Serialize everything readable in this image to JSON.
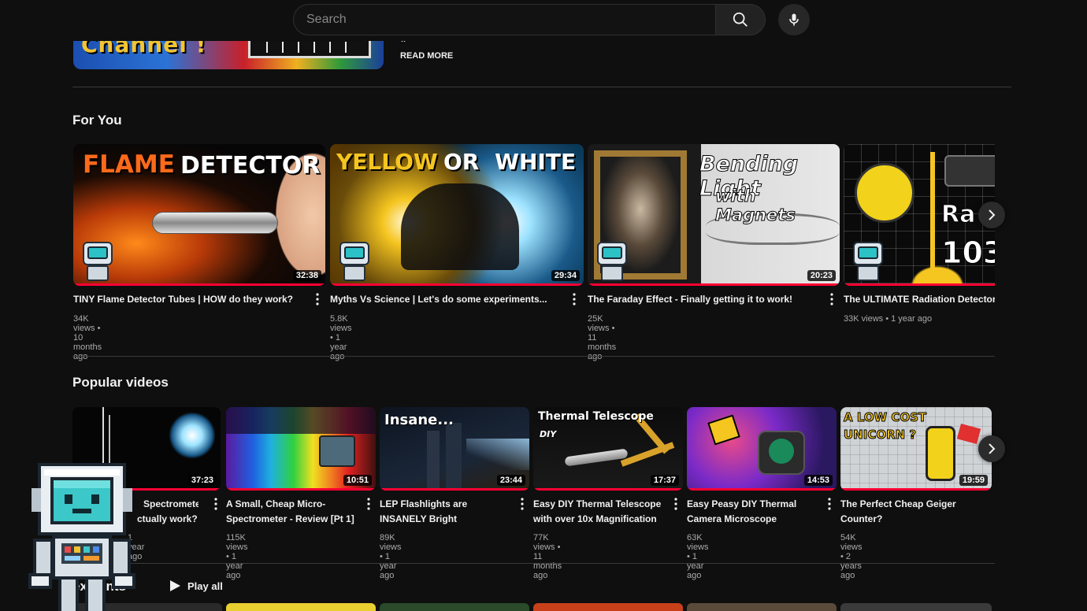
{
  "search": {
    "placeholder": "Search"
  },
  "icons": {
    "search": "search-icon",
    "mic": "mic-icon",
    "next": "chevron-right-icon",
    "menu": "more-vert-icon",
    "play": "play-icon"
  },
  "banner": {
    "text": "Channel !",
    "dots": "..",
    "read_more": "READ MORE"
  },
  "for_you": {
    "title": "For You",
    "videos": [
      {
        "title": "TINY Flame Detector Tubes | HOW do they work?",
        "views": "34K views",
        "age": "10 months ago",
        "duration": "32:38",
        "thumb_text_1": "FLAME",
        "thumb_text_2": "DETECTOR"
      },
      {
        "title": "Myths Vs Science | Let's do some experiments...",
        "views": "5.8K views",
        "age": "1 year ago",
        "duration": "29:34",
        "thumb_text_1": "YELLOW",
        "thumb_text_2": "OR WHITE"
      },
      {
        "title": "The Faraday Effect - Finally getting it to work!",
        "views": "25K views",
        "age": "11 months ago",
        "duration": "20:23",
        "thumb_text_1": "Bending Light",
        "thumb_text_2": "with Magnets"
      },
      {
        "title": "The ULTIMATE Radiation Detector",
        "views": "33K views",
        "age": "1 year ago",
        "duration": "",
        "thumb_text_1": "Ra",
        "thumb_text_2": "103"
      }
    ]
  },
  "popular": {
    "title": "Popular videos",
    "videos": [
      {
        "title_1": "Spectrometer",
        "title_2": "ctually work?",
        "views": "",
        "age": "1 year ago",
        "duration": "37:23"
      },
      {
        "title_1": "A Small, Cheap Micro-",
        "title_2": "Spectrometer - Review [Pt 1]",
        "views": "115K views",
        "age": "1 year ago",
        "duration": "10:51"
      },
      {
        "title_1": "LEP Flashlights are",
        "title_2": "INSANELY Bright",
        "views": "89K views",
        "age": "1 year ago",
        "duration": "23:44",
        "thumb_text": "Insane..."
      },
      {
        "title_1": "Easy DIY Thermal Telescope",
        "title_2": "with over 10x Magnification",
        "views": "77K views",
        "age": "11 months ago",
        "duration": "17:37",
        "thumb_text": "Thermal Telescope",
        "thumb_text_2": "DIY"
      },
      {
        "title_1": "Easy Peasy DIY Thermal",
        "title_2": "Camera Microscope",
        "views": "63K views",
        "age": "1 year ago",
        "duration": "14:53"
      },
      {
        "title_1": "The Perfect Cheap Geiger",
        "title_2": "Counter?",
        "views": "54K views",
        "age": "2 years ago",
        "duration": "19:59",
        "thumb_text": "A LOW COST",
        "thumb_text_2": "UNICORN ?"
      }
    ]
  },
  "next_section": {
    "title": "ex...ents",
    "play_all": "Play all"
  },
  "colors": {
    "background": "#0f0f0f",
    "progress": "#ff0033",
    "text": "#f1f1f1",
    "meta": "#aaaaaa"
  }
}
